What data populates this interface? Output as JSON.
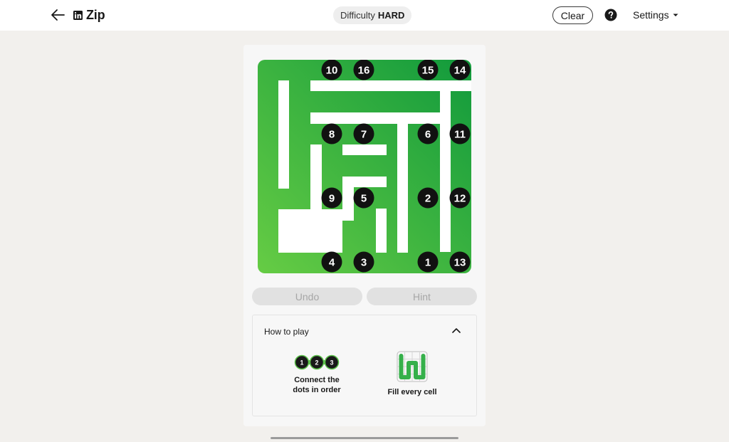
{
  "header": {
    "back_icon": "arrow-left-icon",
    "brand_icon": "linkedin-logo-icon",
    "title": "Zip",
    "difficulty_label": "Difficulty",
    "difficulty_value": "HARD",
    "clear_label": "Clear",
    "help_icon": "question-circle-icon",
    "settings_label": "Settings",
    "settings_icon": "caret-down-icon"
  },
  "board": {
    "rows": 4,
    "cols": 4,
    "path_color_start": "#66cc44",
    "path_color_end": "#119a3c",
    "dots": [
      {
        "label": "1",
        "row": 3,
        "col": 4
      },
      {
        "label": "2",
        "row": 2,
        "col": 4
      },
      {
        "label": "3",
        "row": 3,
        "col": 2
      },
      {
        "label": "4",
        "row": 3,
        "col": 1
      },
      {
        "label": "5",
        "row": 2,
        "col": 2
      },
      {
        "label": "6",
        "row": 1,
        "col": 4
      },
      {
        "label": "7",
        "row": 1,
        "col": 2
      },
      {
        "label": "8",
        "row": 1,
        "col": 1
      },
      {
        "label": "9",
        "row": 2,
        "col": 1
      },
      {
        "label": "10",
        "row": 0,
        "col": 1
      },
      {
        "label": "11",
        "row": 1,
        "col": 5
      },
      {
        "label": "12",
        "row": 2,
        "col": 5
      },
      {
        "label": "13",
        "row": 3,
        "col": 5
      },
      {
        "label": "14",
        "row": 0,
        "col": 5
      },
      {
        "label": "15",
        "row": 0,
        "col": 4
      },
      {
        "label": "16",
        "row": 0,
        "col": 2
      }
    ]
  },
  "actions": {
    "undo_label": "Undo",
    "hint_label": "Hint"
  },
  "how_to_play": {
    "title": "How to play",
    "toggle_icon": "chevron-up-icon",
    "tips": [
      {
        "icon": "numbered-dots-icon",
        "dots": [
          "1",
          "2",
          "3"
        ],
        "line1": "Connect the",
        "line2": "dots in order"
      },
      {
        "icon": "fill-grid-icon",
        "line1": "Fill every cell"
      }
    ]
  }
}
